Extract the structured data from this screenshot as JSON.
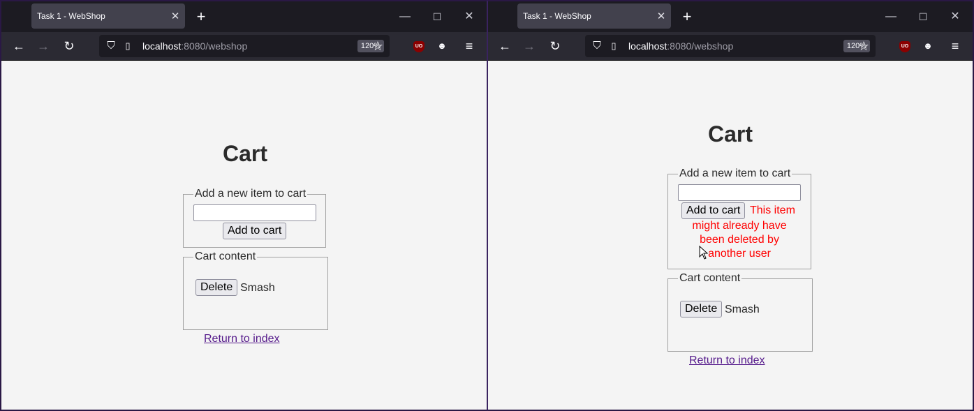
{
  "browser": {
    "tab_title": "Task 1 - WebShop",
    "tab_close_glyph": "✕",
    "new_tab_glyph": "+",
    "url_host": "localhost",
    "url_rest": ":8080/webshop",
    "zoom_level": "120%",
    "ublock_label": "UO",
    "window_controls": [
      "—",
      "☐",
      "✕"
    ]
  },
  "left_page": {
    "heading": "Cart",
    "add_legend": "Add a new item to cart",
    "input_value": "",
    "add_button": "Add to cart",
    "cart_legend": "Cart content",
    "delete_button": "Delete",
    "item_name": "Smash",
    "return_link": "Return to index"
  },
  "right_page": {
    "heading": "Cart",
    "add_legend": "Add a new item to cart",
    "input_value": "",
    "add_button": "Add to cart",
    "error_line_1": "This item",
    "error_line_2": "might already have",
    "error_line_3": "been deleted by",
    "error_line_4": "another user",
    "cart_legend": "Cart content",
    "delete_button": "Delete",
    "item_name": "Smash",
    "return_link": "Return to index"
  },
  "colors": {
    "chrome_bg": "#1c1b22",
    "toolbar_bg": "#2b2a33",
    "page_bg": "#f4f4f4",
    "error_red": "#ff0000",
    "link_visited": "#551a8b"
  },
  "icons": [
    "back-arrow-icon",
    "forward-arrow-icon",
    "reload-icon",
    "shield-icon",
    "page-icon",
    "star-icon",
    "ublock-origin-icon",
    "reddit-enhancement-icon",
    "hamburger-menu-icon",
    "mouse-cursor-icon"
  ]
}
